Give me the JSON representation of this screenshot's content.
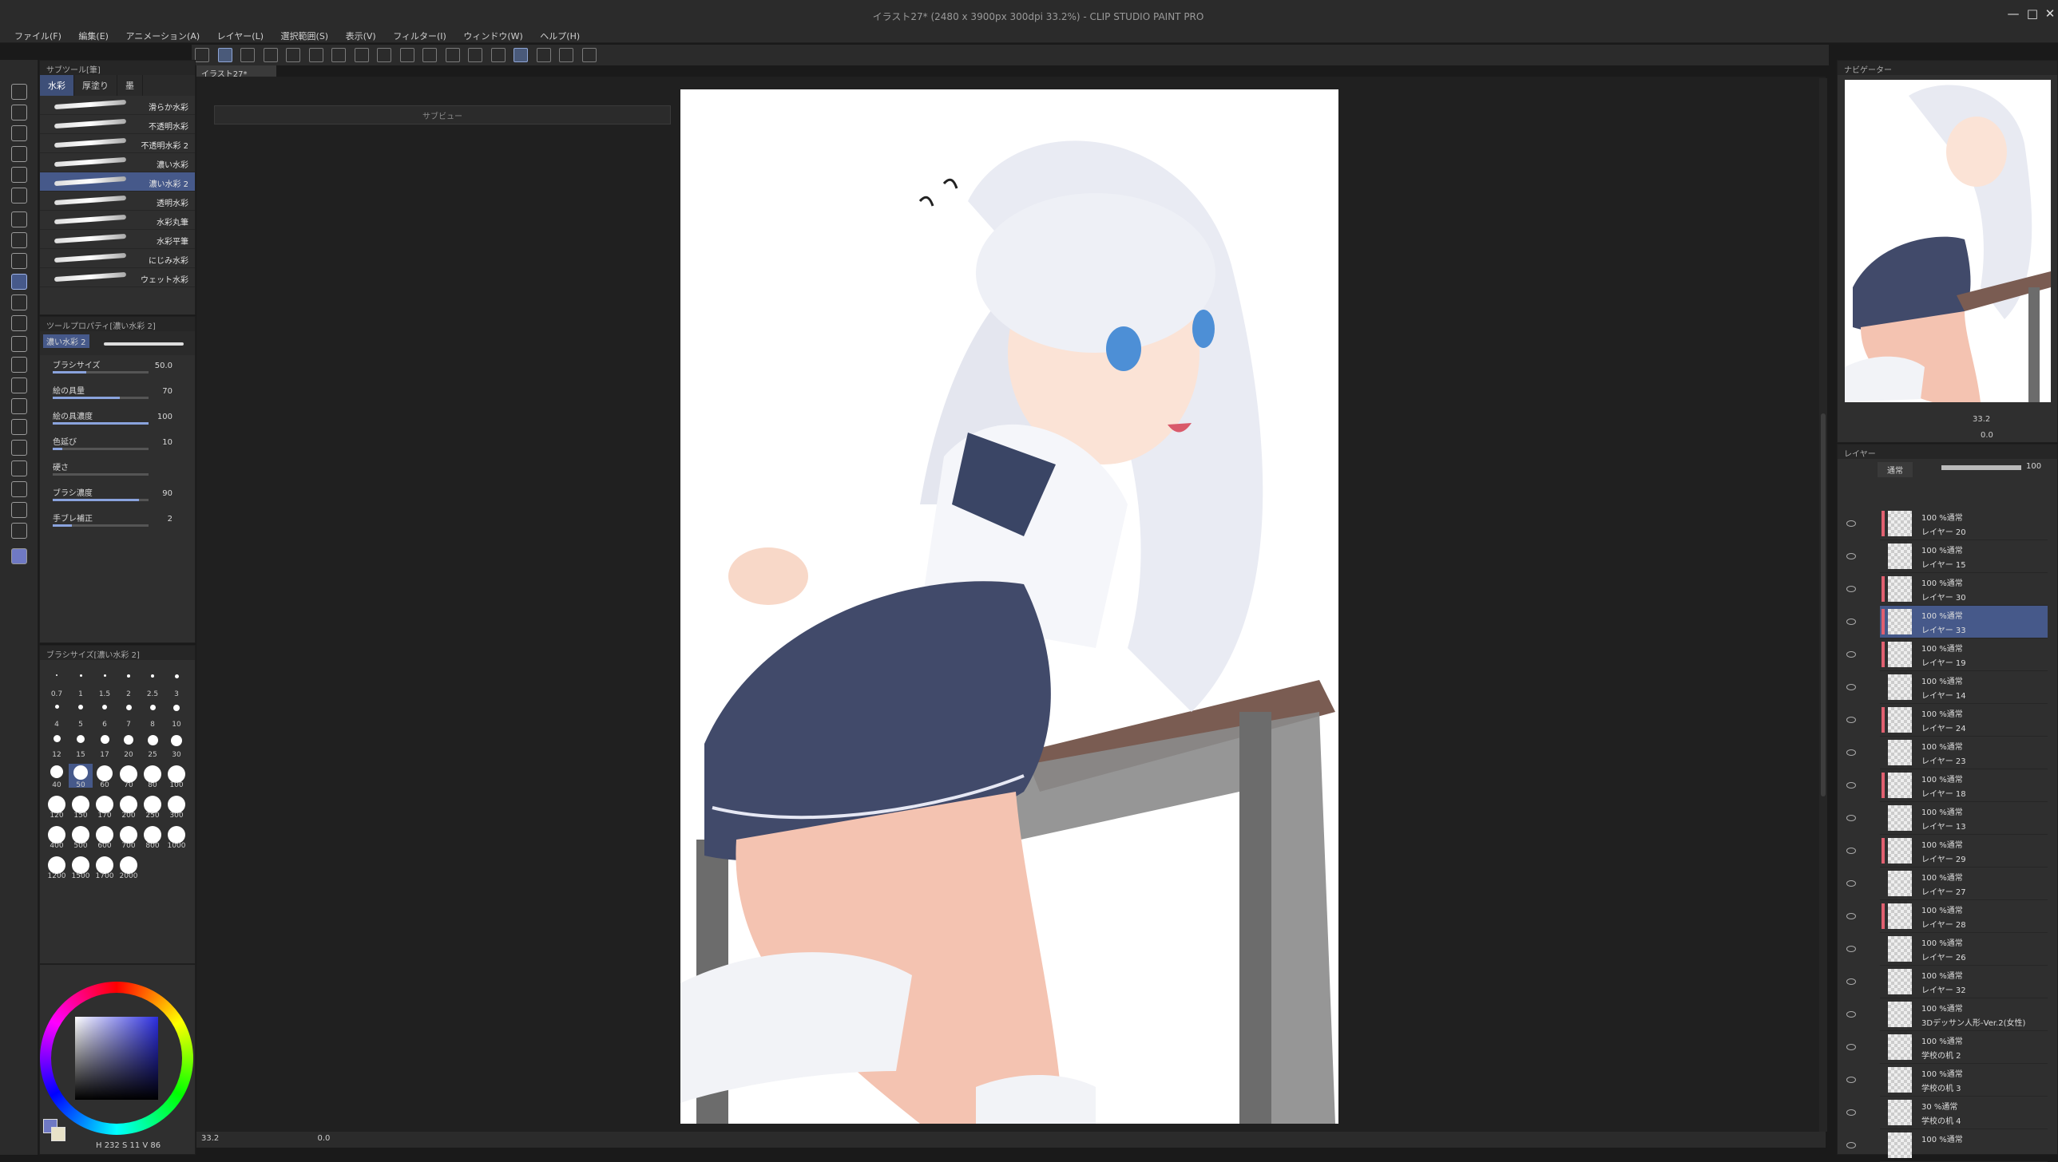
{
  "window": {
    "title": "イラスト27* (2480 x 3900px 300dpi 33.2%) - CLIP STUDIO PAINT PRO",
    "controls": [
      "—",
      "□",
      "✕"
    ]
  },
  "menu": [
    "ファイル(F)",
    "編集(E)",
    "アニメーション(A)",
    "レイヤー(L)",
    "選択範囲(S)",
    "表示(V)",
    "フィルター(I)",
    "ウィンドウ(W)",
    "ヘルプ(H)"
  ],
  "document_tab": "イラスト27*",
  "subview_title": "サブビュー",
  "subtool": {
    "header": "サブツール[筆]",
    "tabs": [
      "水彩",
      "厚塗り",
      "墨"
    ],
    "active_tab": 0,
    "brushes": [
      "滑らか水彩",
      "不透明水彩",
      "不透明水彩 2",
      "濃い水彩",
      "濃い水彩 2",
      "透明水彩",
      "水彩丸筆",
      "水彩平筆",
      "にじみ水彩",
      "ウェット水彩"
    ],
    "selected_brush": 4
  },
  "tool_property": {
    "header": "ツールプロパティ[濃い水彩 2]",
    "preview_label": "濃い水彩 2",
    "props": [
      {
        "label": "ブラシサイズ",
        "value": "50.0",
        "level": 0.35
      },
      {
        "label": "絵の具量",
        "value": "70",
        "level": 0.7
      },
      {
        "label": "絵の具濃度",
        "value": "100",
        "level": 1.0
      },
      {
        "label": "色延び",
        "value": "10",
        "level": 0.1
      },
      {
        "label": "硬さ",
        "value": "",
        "level": 0
      },
      {
        "label": "ブラシ濃度",
        "value": "90",
        "level": 0.9
      },
      {
        "label": "手ブレ補正",
        "value": "2",
        "level": 0.2
      }
    ]
  },
  "brush_size": {
    "header": "ブラシサイズ[濃い水彩 2]",
    "sizes": [
      "0.7",
      "1",
      "1.5",
      "2",
      "2.5",
      "3",
      "4",
      "5",
      "6",
      "7",
      "8",
      "10",
      "12",
      "15",
      "17",
      "20",
      "25",
      "30",
      "40",
      "50",
      "60",
      "70",
      "80",
      "100",
      "120",
      "150",
      "170",
      "200",
      "250",
      "300",
      "400",
      "500",
      "600",
      "700",
      "800",
      "1000",
      "1200",
      "1500",
      "1700",
      "2000"
    ],
    "selected": "50"
  },
  "color": {
    "hue": "#2c2ee0",
    "main": "#6f79c4",
    "sub": "#e8e2c8",
    "status": "H 232   S 11   V 86"
  },
  "canvas_status": {
    "zoom": "33.2",
    "angle": "0.0"
  },
  "navigator": {
    "header": "ナビゲーター",
    "zoom": "33.2",
    "angle": "0.0"
  },
  "layers": {
    "header": "レイヤー",
    "blend_mode": "通常",
    "opacity": "100",
    "items": [
      {
        "mode": "100 %通常",
        "name": "レイヤー 20",
        "clip": true
      },
      {
        "mode": "100 %通常",
        "name": "レイヤー 15",
        "clip": false
      },
      {
        "mode": "100 %通常",
        "name": "レイヤー 30",
        "clip": true
      },
      {
        "mode": "100 %通常",
        "name": "レイヤー 33",
        "clip": true,
        "selected": true
      },
      {
        "mode": "100 %通常",
        "name": "レイヤー 19",
        "clip": true
      },
      {
        "mode": "100 %通常",
        "name": "レイヤー 14",
        "clip": false
      },
      {
        "mode": "100 %通常",
        "name": "レイヤー 24",
        "clip": true
      },
      {
        "mode": "100 %通常",
        "name": "レイヤー 23",
        "clip": false
      },
      {
        "mode": "100 %通常",
        "name": "レイヤー 18",
        "clip": true
      },
      {
        "mode": "100 %通常",
        "name": "レイヤー 13",
        "clip": false
      },
      {
        "mode": "100 %通常",
        "name": "レイヤー 29",
        "clip": true
      },
      {
        "mode": "100 %通常",
        "name": "レイヤー 27",
        "clip": false
      },
      {
        "mode": "100 %通常",
        "name": "レイヤー 28",
        "clip": true
      },
      {
        "mode": "100 %通常",
        "name": "レイヤー 26",
        "clip": false
      },
      {
        "mode": "100 %通常",
        "name": "レイヤー 32",
        "clip": false
      },
      {
        "mode": "100 %通常",
        "name": "3Dデッサン人形-Ver.2(女性)",
        "clip": false
      },
      {
        "mode": "100 %通常",
        "name": "学校の机 2",
        "clip": false
      },
      {
        "mode": "100 %通常",
        "name": "学校の机 3",
        "clip": false
      },
      {
        "mode": "30 %通常",
        "name": "学校の机 4",
        "clip": false
      },
      {
        "mode": "100 %通常",
        "name": "",
        "clip": false
      }
    ]
  }
}
